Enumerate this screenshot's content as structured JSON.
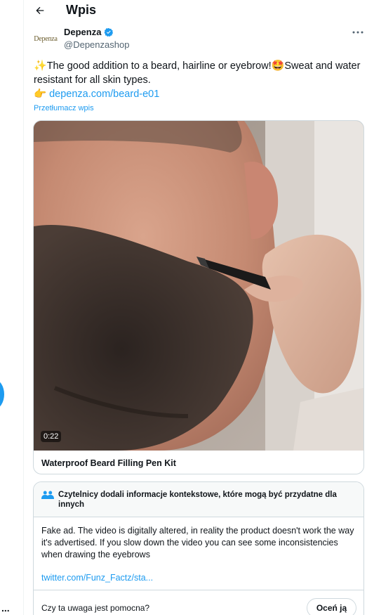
{
  "header": {
    "title": "Wpis",
    "back_icon": "arrow-left-icon"
  },
  "author": {
    "avatar_text": "Depenza",
    "name": "Depenza",
    "verified_icon": "verified-badge-icon",
    "verified_color": "#1d9bf0",
    "handle": "@Depenzashop"
  },
  "tweet": {
    "emoji_sparkles": "✨",
    "text_part1": "The good addition to a beard, hairline or eyebrow!",
    "emoji_star_eyes": "🤩",
    "text_part2": "Sweat and water resistant for all skin types.",
    "emoji_pointing": "👉",
    "link": "depenza.com/beard-e01",
    "translate_label": "Przetłumacz wpis"
  },
  "media": {
    "duration": "0:22",
    "caption": "Waterproof Beard Filling Pen Kit"
  },
  "community_note": {
    "icon": "people-icon",
    "title": "Czytelnicy dodali informacje kontekstowe, które mogą być przydatne dla innych",
    "body": "Fake ad. The video is digitally altered, in reality the product doesn't work the way it's advertised. If you slow down the video you can see some inconsistencies when drawing the eyebrows",
    "link": "twitter.com/Funz_Factz/sta...",
    "helpful_question": "Czy ta uwaga jest pomocna?",
    "rate_button": "Oceń ją"
  },
  "sidebar": {
    "more_label": "...",
    "accent_color": "#1d9bf0"
  }
}
